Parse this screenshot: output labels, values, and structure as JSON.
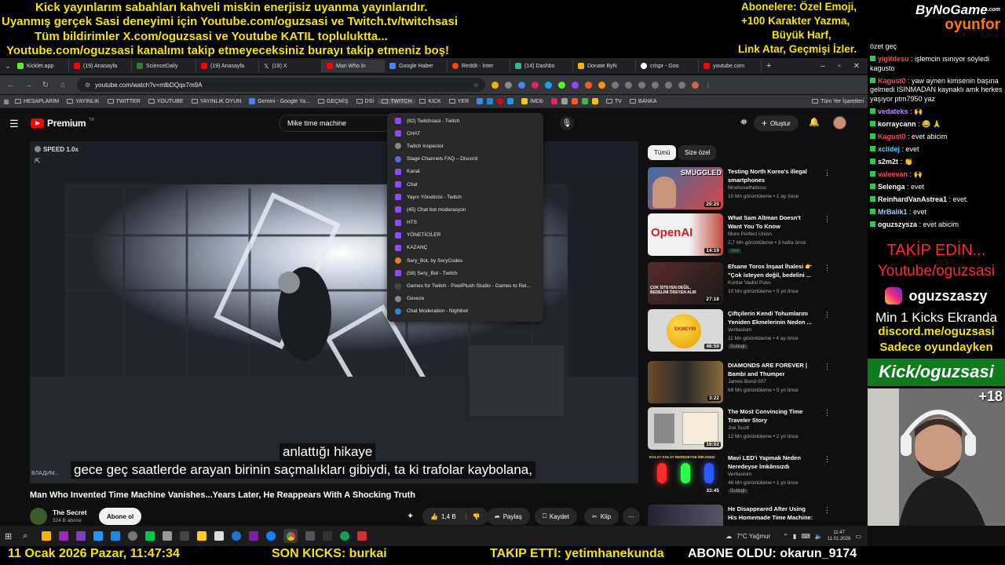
{
  "banner": {
    "lines": [
      "Kick yayınlarım sabahları kahveli miskin enerjisiz uyanma yayınlarıdır.",
      "Uyanmış gerçek Sasi deneyimi için Youtube.com/oguzsasi ve Twitch.tv/twitchsasi",
      "Tüm bildirimler X.com/oguzsasi ve Youtube KATIL topluluktta...",
      "Youtube.com/oguzsasi kanalımı takip etmeyeceksiniz burayı takip etmeniz boş!"
    ],
    "right_lines": [
      "Abonelere: Özel Emoji,",
      "+100 Karakter Yazma,",
      "Büyük Harf,",
      "Link Atar, Geçmişi İzler."
    ],
    "logo_top": "ByNoGame",
    "logo_com": ".com",
    "logo_bottom": "oyunfor"
  },
  "browser": {
    "tabs": [
      "Kicklet.app",
      "(19) Anasayfa",
      "ScienceDaily",
      "(19) Anasayfa",
      "(19) X",
      "Man Who In",
      "Google Haber",
      "Reddit - İnter",
      "(14) Dashbo",
      "Donate ByN",
      "crispr - Goo",
      "youtube.com"
    ],
    "url": "youtube.com/watch?v=mlbDQqx7m9A",
    "bookmarks": [
      "HESAPLARIM",
      "YAYINLIK",
      "TWITTER",
      "YOUTUBE",
      "YAYINLIK OYUN",
      "Gemini - Google Ya...",
      "GEÇMİŞ",
      "DSİ",
      "TWITCH",
      "KICK",
      "YER",
      "IMDb",
      "BANKA",
      "Tüm Yer İşaretleri"
    ],
    "bookmark_tv": "TV",
    "dropdown": [
      "(82) Twitchsasi - Twitch",
      "CHAT",
      "Twitch Inspector",
      "Stage Channels FAQ – Discord",
      "Kanal",
      "Chat",
      "Yayın Yöneticisi - Twitch",
      "(45) Chat bot moderasyon",
      "HTS",
      "YÖNETİCİLER",
      "KAZANÇ",
      "Sery_Bot, by SeryCodes",
      "(58) Sery_Bot - Twitch",
      "Games for Twitch - PixelPlush Studio - Games to Rel...",
      "Geveze",
      "Chat Moderation - Nightbot"
    ]
  },
  "youtube": {
    "logo": "Premium",
    "logo_tm": "TR",
    "search_value": "Mike time machine",
    "create": "Oluştur",
    "speed": "SPEED 1.0x",
    "subtitle_1": "anlattığı hikaye",
    "subtitle_2": "gece geç saatlerde arayan birinin saçmalıkları gibiydi, ta ki trafolar kaybolana,",
    "video_watermark": "ВЛАДИМ...",
    "title": "Man Who Invented Time Machine Vanishes...Years Later, He Reappears With A Shocking Truth",
    "channel": "The Secret",
    "subs": "324 B abone",
    "subscribe": "Abone ol",
    "likes": "1,4 B",
    "share": "Paylaş",
    "save": "Kaydet",
    "clip": "Klip",
    "chips": [
      "Tümü",
      "Size özel"
    ],
    "recommendations": [
      {
        "title": "Testing North Korea's illegal smartphones",
        "channel": "Mrwhosetheboss",
        "meta": "10 Mn görüntüleme • 1 ay önce",
        "duration": "20:20",
        "badge": "",
        "thumb_text": "SMUGGLED"
      },
      {
        "title": "What Sam Altman Doesn't Want You To Know",
        "channel": "More Perfect Union",
        "meta": "2,7 Mn görüntüleme • 3 hafta önce",
        "duration": "14:19",
        "badge": "Yeni",
        "thumb_text": "OpenAI"
      },
      {
        "title": "Efsane Toros İnşaat İhalesi 👉 \"Çok isteyen değil, bedelini ...",
        "channel": "Kurtlar Vadisi Pusu",
        "meta": "10 Mn görüntüleme • 5 yıl önce",
        "duration": "27:18",
        "badge": "",
        "thumb_text": "ÇOK İSTEYEN DEĞİL, BEDELİNİ ÖDEYEN ALIR"
      },
      {
        "title": "Çiftçilerin Kendi Tohumlarını Yeniden Ekmelerinin Neden ...",
        "channel": "Veritasium",
        "meta": "11 Mn görüntüleme • 4 ay önce",
        "duration": "46:59",
        "badge": "Dublajlı",
        "thumb_text": "EKMEYIN"
      },
      {
        "title": "DIAMONDS ARE FOREVER | Bambi and Thumper",
        "channel": "James Bond 007",
        "meta": "69 Mn görüntüleme • 5 yıl önce",
        "duration": "3:22",
        "badge": "",
        "thumb_text": ""
      },
      {
        "title": "The Most Convincing Time Traveler Story",
        "channel": "Joe Scott",
        "meta": "12 Mn görüntüleme • 2 yıl önce",
        "duration": "16:02",
        "badge": "",
        "thumb_text": ""
      },
      {
        "title": "Mavi LED'i Yapmak Neden Neredeyse İmkânsızdı",
        "channel": "Veritasium",
        "meta": "46 Mn görüntüleme • 1 yıl önce",
        "duration": "33:45",
        "badge": "Dublajlı",
        "thumb_text": "KOLAY KOLAY NEREDEYSE İMKANSIZ"
      },
      {
        "title": "He Disappeared After Using His Homemade Time Machine: Th...",
        "channel": "",
        "meta": "",
        "duration": "",
        "badge": "",
        "thumb_text": ""
      }
    ]
  },
  "chat": {
    "header": "özet geç",
    "messages": [
      {
        "user": "yigitdesu",
        "text": ": işlemcin ısınıyor söyledi kagusto",
        "color": "#ff4a4a"
      },
      {
        "user": "Kagust0",
        "text": ": yaw aynen kimsenin başına gelmedi ISINMADAN kaynaklı amk herkes yaşıyor ptm7950 yaz",
        "color": "#ff4a4a"
      },
      {
        "user": "vedateks",
        "text": ": 🙌",
        "color": "#b98cff"
      },
      {
        "user": "korraycann",
        "text": ": 😂 🙏",
        "color": "#ffffff"
      },
      {
        "user": "Kagust0",
        "text": ": evet abicim",
        "color": "#ff4a4a"
      },
      {
        "user": "xclidej",
        "text": ": evet",
        "color": "#4ed3ff"
      },
      {
        "user": "s2m2t",
        "text": ": 👏",
        "color": "#ffffff"
      },
      {
        "user": "valeevan",
        "text": ": 🙌",
        "color": "#ff4a4a"
      },
      {
        "user": "Selenga",
        "text": ": evet",
        "color": "#ffffff"
      },
      {
        "user": "ReinhardVanAstrea1",
        "text": ": evet.",
        "color": "#ffffff"
      },
      {
        "user": "MrBalik1",
        "text": ": evet",
        "color": "#9fd0ff"
      },
      {
        "user": "oguzszysza",
        "text": ": evet abicim",
        "color": "#ffffff"
      }
    ]
  },
  "promo": {
    "follow": "TAKİP EDİN...",
    "youtube": "Youtube/oguzsasi",
    "instagram": "oguzszaszy",
    "kicks": "Min 1 Kicks Ekranda",
    "discord": "discord.me/oguzsasi",
    "only_game": "Sadece oyundayken",
    "kick": "Kick/oguzsasi",
    "age": "+18"
  },
  "taskbar": {
    "weather": "7°C  Yağmur",
    "time": "11:47",
    "date": "11.01.2026"
  },
  "bottom": {
    "datetime": "11 Ocak 2026 Pazar, 11:47:34",
    "last_kicks": "SON KICKS: burkai",
    "followed": "TAKIP ETTI: yetimhanekunda",
    "subscribed": "ABONE OLDU: okarun_9174"
  },
  "colors": {
    "banner_yellow": "#f5e30a",
    "youtube_red": "#ff0000",
    "chat_green": "#35c553",
    "kick_green": "#53fc18",
    "promo_red": "#ff2a2a"
  }
}
